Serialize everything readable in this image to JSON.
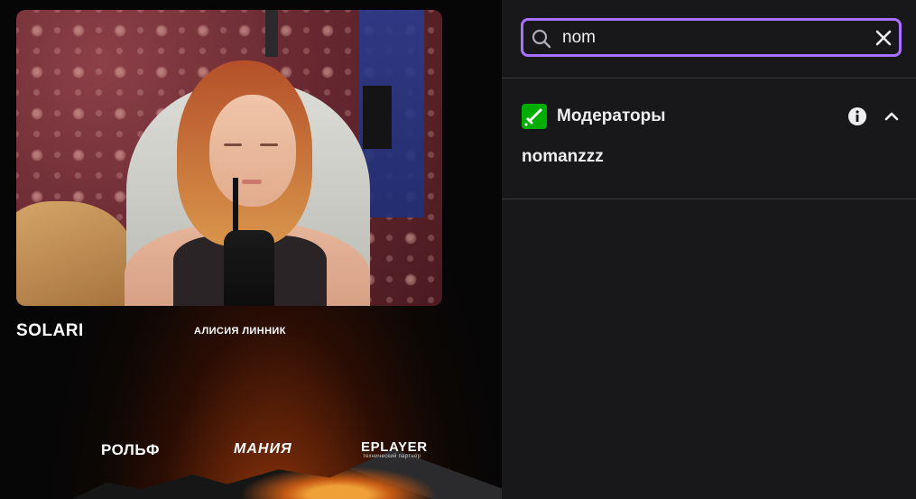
{
  "stream": {
    "brand_title": "SOLARI",
    "streamer_name": "АЛИСИЯ ЛИННИК",
    "sponsors": [
      {
        "name": "РОЛЬФ"
      },
      {
        "name": "МАНИЯ"
      },
      {
        "name": "EPLAYER",
        "caption": "технический партнёр"
      }
    ]
  },
  "search": {
    "value": "nom",
    "clear_icon": "close-icon",
    "search_icon": "search-icon",
    "accent_color": "#a970ff"
  },
  "results": {
    "group_title": "Модераторы",
    "group_badge_color": "#00ad03",
    "group_icon": "sword-icon",
    "info_icon": "info-icon",
    "toggle_icon": "chevron-up-icon",
    "items": [
      {
        "username": "nomanzzz"
      }
    ]
  }
}
